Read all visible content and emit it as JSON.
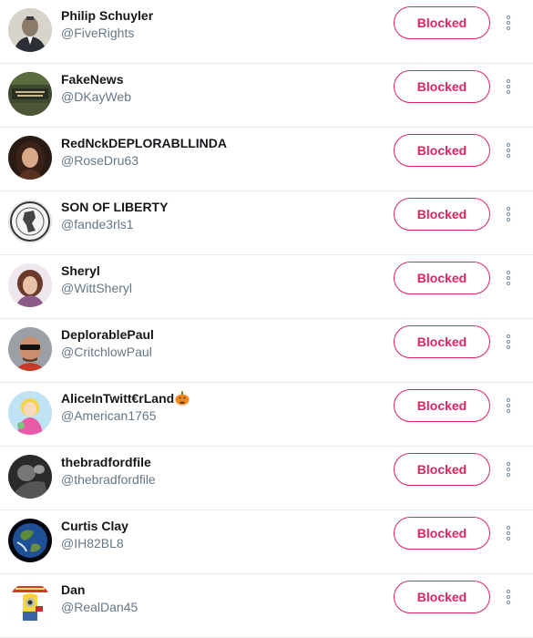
{
  "accent_color": "#e0245e",
  "more_icon": "vertical-ellipsis-icon",
  "users": [
    {
      "name": "Philip Schuyler",
      "handle": "@FiveRights",
      "button_label": "Blocked",
      "avatar": "portrait-photo"
    },
    {
      "name": "FakeNews",
      "handle": "@DKayWeb",
      "button_label": "Blocked",
      "avatar": "sign-photo"
    },
    {
      "name": "RedNckDEPLORABLLINDA",
      "handle": "@RoseDru63",
      "button_label": "Blocked",
      "avatar": "woman-photo"
    },
    {
      "name": "SON OF LIBERTY",
      "handle": "@fande3rls1",
      "button_label": "Blocked",
      "avatar": "emblem-photo"
    },
    {
      "name": "Sheryl",
      "handle": "@WittSheryl",
      "button_label": "Blocked",
      "avatar": "woman-photo"
    },
    {
      "name": "DeplorablePaul",
      "handle": "@CritchlowPaul",
      "button_label": "Blocked",
      "avatar": "man-sunglasses-photo"
    },
    {
      "name": "AliceInTwitt€rLand",
      "handle": "@American1765",
      "button_label": "Blocked",
      "avatar": "cartoon-photo",
      "name_emoji": "jack-o-lantern-icon"
    },
    {
      "name": "thebradfordfile",
      "handle": "@thebradfordfile",
      "button_label": "Blocked",
      "avatar": "bw-photo"
    },
    {
      "name": "Curtis Clay",
      "handle": "@IH82BL8",
      "button_label": "Blocked",
      "avatar": "earth-photo"
    },
    {
      "name": "Dan",
      "handle": "@RealDan45",
      "button_label": "Blocked",
      "avatar": "minion-deplorable-photo"
    }
  ]
}
